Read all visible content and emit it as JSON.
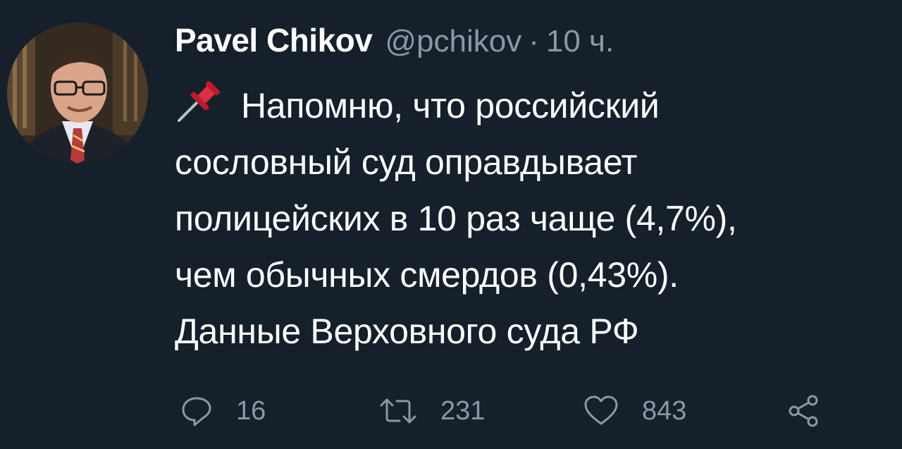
{
  "tweet": {
    "author_name": "Pavel Chikov",
    "handle": "@pchikov",
    "separator": "·",
    "time": "10 ч.",
    "pin_icon": "pushpin-emoji",
    "text_lines": [
      "Напомню, что российский",
      "сословный суд оправдывает",
      "полицейских в 10 раз чаще (4,7%),",
      "чем обычных смердов (0,43%).",
      "Данные Верховного суда РФ"
    ]
  },
  "actions": {
    "reply_count": "16",
    "retweet_count": "231",
    "like_count": "843",
    "reply_icon": "reply-icon",
    "retweet_icon": "retweet-icon",
    "like_icon": "heart-icon",
    "share_icon": "share-icon"
  },
  "colors": {
    "background": "#15202b",
    "text": "#ffffff",
    "secondary": "#8899a6",
    "pin_red": "#dd2e44"
  }
}
